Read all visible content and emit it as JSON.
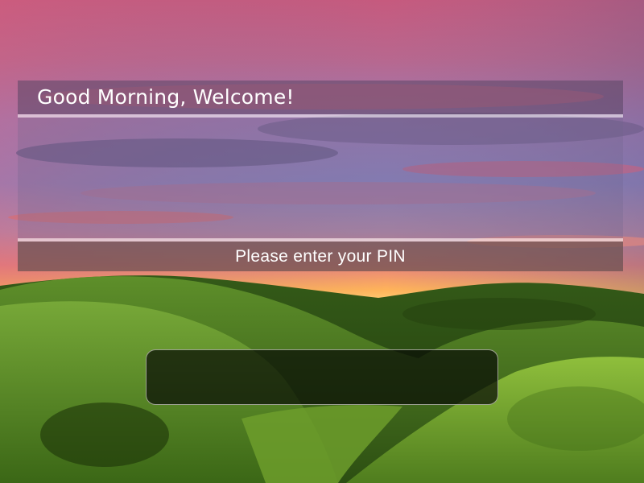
{
  "greeting": {
    "text": "Good Morning, Welcome!"
  },
  "message_area": {
    "text": ""
  },
  "prompt": {
    "text": "Please enter your PIN"
  },
  "pin_input": {
    "value": "",
    "placeholder": ""
  },
  "colors": {
    "sky_top": "#c65a7e",
    "sky_mid": "#8a7fb0",
    "horizon": "#ffb347",
    "hills": "#3d6a1c",
    "greeting_bar": "#5a4664",
    "prompt_bar": "#695050",
    "input_bg": "#080c06"
  }
}
